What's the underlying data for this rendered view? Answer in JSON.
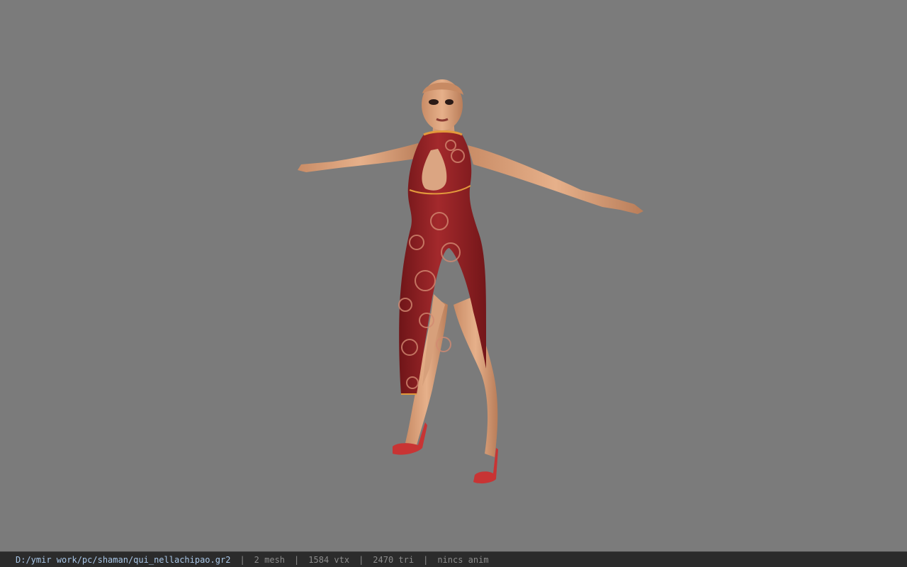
{
  "viewport": {
    "background": "#7b7b7b",
    "model_name": "3d-character-model"
  },
  "statusbar": {
    "file_path": "D:/ymir work/pc/shaman/qui_nellachipao.gr2",
    "separator": "|",
    "mesh": "2 mesh",
    "vertices": "1584 vtx",
    "triangles": "2470 tri",
    "anim": "nincs anim"
  },
  "colors": {
    "status_bg": "#2b2b2b",
    "path_text": "#a9c7e8",
    "stat_text": "#8c8c8c",
    "dress": "#8e1f22",
    "skin": "#d9a07a"
  }
}
